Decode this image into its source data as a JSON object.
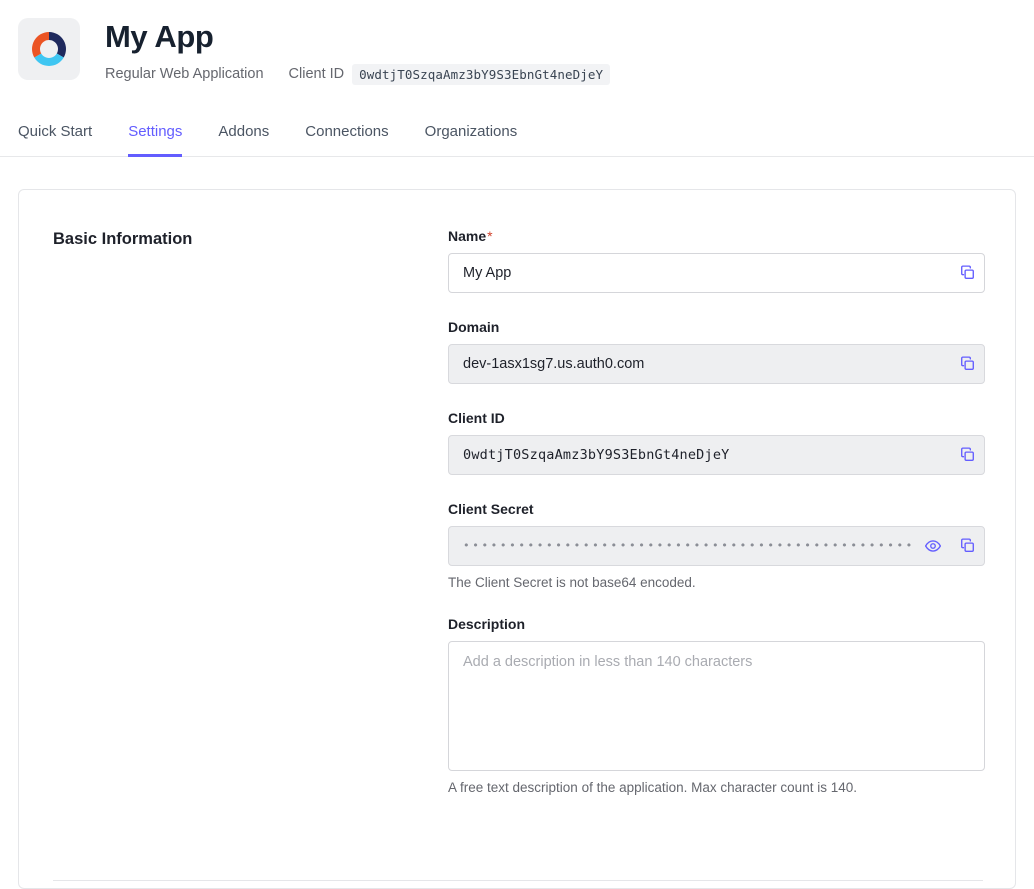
{
  "header": {
    "logo_icon": "auth0-donut-logo",
    "title": "My App",
    "app_type": "Regular Web Application",
    "client_id_label": "Client ID",
    "client_id_value": "0wdtjT0SzqaAmz3bY9S3EbnGt4neDjeY"
  },
  "tabs": [
    {
      "label": "Quick Start",
      "active": false
    },
    {
      "label": "Settings",
      "active": true
    },
    {
      "label": "Addons",
      "active": false
    },
    {
      "label": "Connections",
      "active": false
    },
    {
      "label": "Organizations",
      "active": false
    }
  ],
  "basic_information": {
    "section_title": "Basic Information",
    "name": {
      "label": "Name",
      "required_marker": "*",
      "value": "My App",
      "copy_icon": "copy-icon"
    },
    "domain": {
      "label": "Domain",
      "value": "dev-1asx1sg7.us.auth0.com",
      "copy_icon": "copy-icon"
    },
    "client_id": {
      "label": "Client ID",
      "value": "0wdtjT0SzqaAmz3bY9S3EbnGt4neDjeY",
      "copy_icon": "copy-icon"
    },
    "client_secret": {
      "label": "Client Secret",
      "masked_value": "••••••••••••••••••••••••••••••••••••••••••••••••••••••••••••••••",
      "reveal_icon": "eye-icon",
      "copy_icon": "copy-icon",
      "helper": "The Client Secret is not base64 encoded."
    },
    "description": {
      "label": "Description",
      "value": "",
      "placeholder": "Add a description in less than 140 characters",
      "helper": "A free text description of the application. Max character count is 140."
    }
  },
  "colors": {
    "accent": "#635dff",
    "required": "#d0412b",
    "logo_orange": "#eb5424",
    "logo_navy": "#1f2a5e",
    "logo_blue": "#3fc6f2"
  }
}
